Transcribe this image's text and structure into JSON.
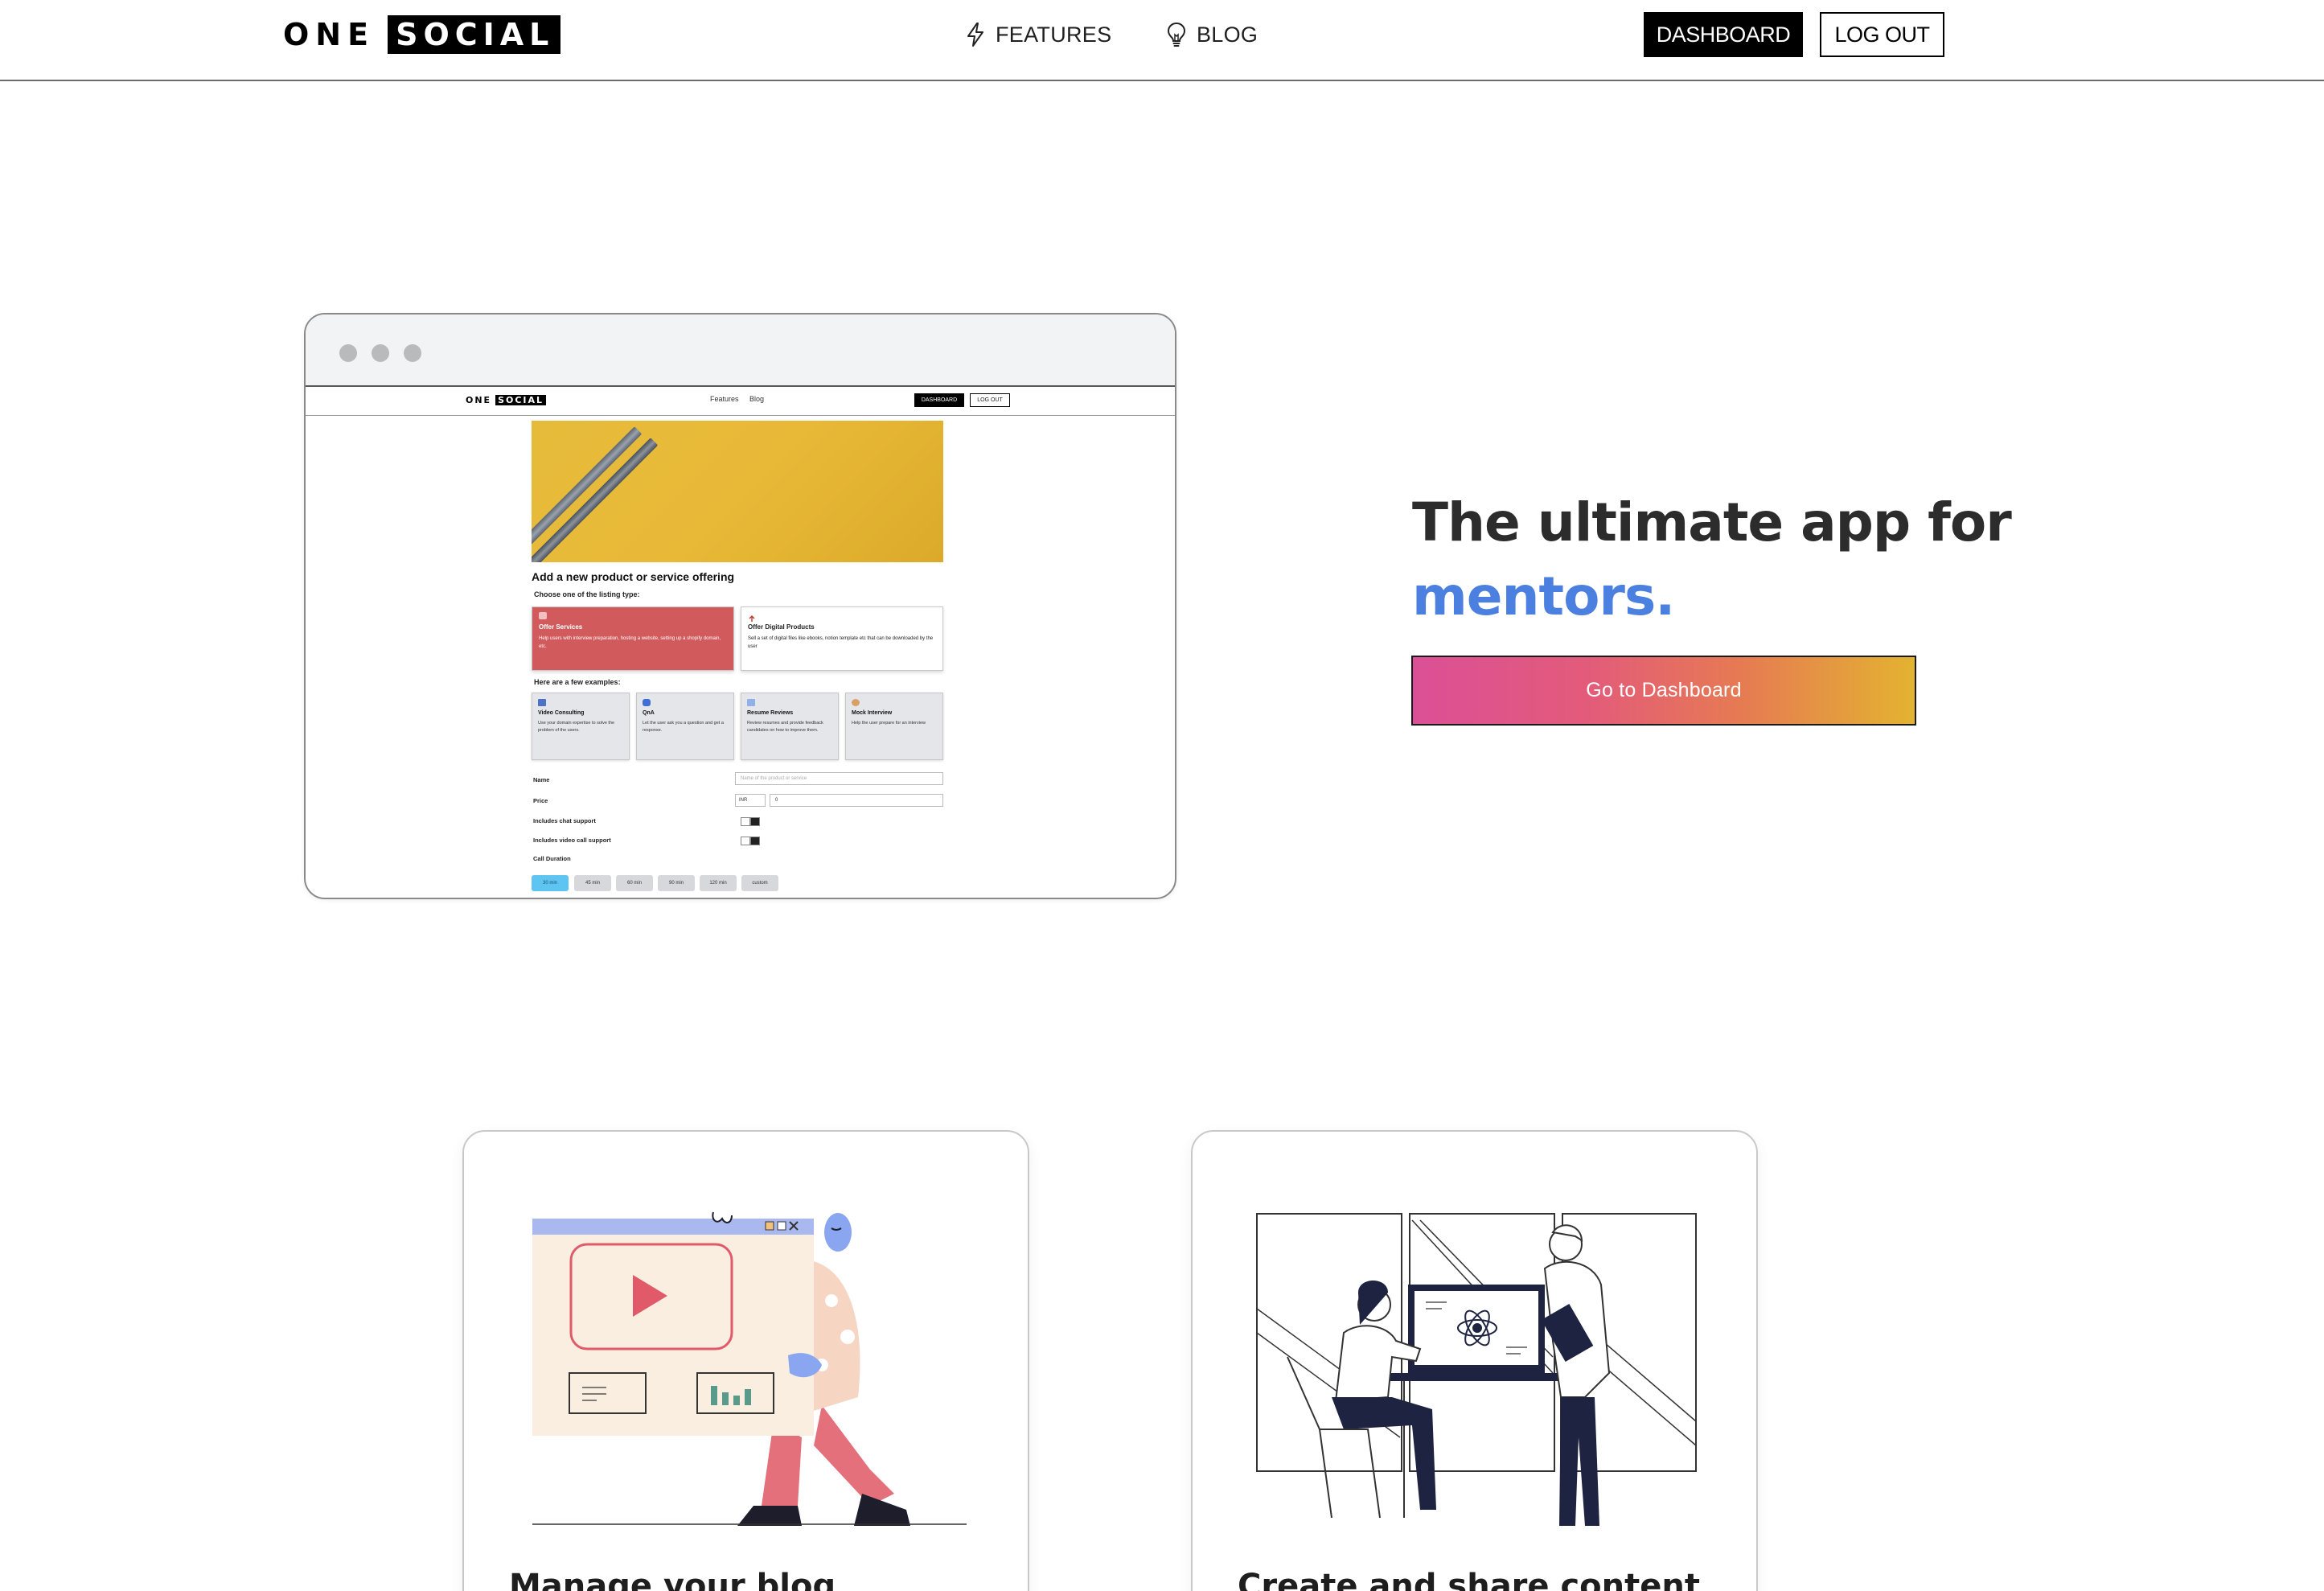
{
  "nav": {
    "logo_one": "ONE",
    "logo_social": "SOCIAL",
    "features_label": "FEATURES",
    "blog_label": "BLOG",
    "dashboard_label": "DASHBOARD",
    "logout_label": "LOG OUT"
  },
  "mockup": {
    "logo_one": "ONE",
    "logo_social": "SOCIAL",
    "nav_features": "Features",
    "nav_blog": "Blog",
    "nav_dashboard": "DASHBOARD",
    "nav_logout": "LOG OUT",
    "form_title": "Add a new product or service offering",
    "listing_prompt": "Choose one of the listing type:",
    "listing_types": [
      {
        "title": "Offer Services",
        "desc": "Help users with interview preparation, hosting a website, setting up a shopify domain, etc."
      },
      {
        "title": "Offer Digital Products",
        "desc": "Sell a set of digital files like ebooks, notion template etc that can be downloaded by the user"
      }
    ],
    "examples_prompt": "Here are a few examples:",
    "examples": [
      {
        "title": "Video Consulting",
        "desc": "Use your domain expertise to solve the problem of the users."
      },
      {
        "title": "QnA",
        "desc": "Let the user ask you a question and get a response."
      },
      {
        "title": "Resume Reviews",
        "desc": "Review resumes and provide feedback candidates on how to improve them."
      },
      {
        "title": "Mock Interview",
        "desc": "Help the user prepare for an interview"
      }
    ],
    "name_label": "Name",
    "name_placeholder": "Name of the product or service",
    "price_label": "Price",
    "currency": "INR",
    "price_value": "0",
    "chat_label": "Includes chat support",
    "video_label": "Includes video call support",
    "duration_label": "Call Duration",
    "durations": [
      "30 min",
      "45 min",
      "60 min",
      "90 min",
      "120 min",
      "custom"
    ]
  },
  "hero": {
    "title_line1": "The ultimate app for",
    "title_accent": "mentors.",
    "cta_label": "Go to Dashboard"
  },
  "features": [
    {
      "title": "Manage your blog"
    },
    {
      "title": "Create and share content"
    }
  ],
  "colors": {
    "accent_blue": "#4b7fe0",
    "cta_gradient": [
      "#dc4f97",
      "#e3b330"
    ],
    "offer_services_red": "#d15a5c",
    "duration_active": "#5ec4f2"
  }
}
